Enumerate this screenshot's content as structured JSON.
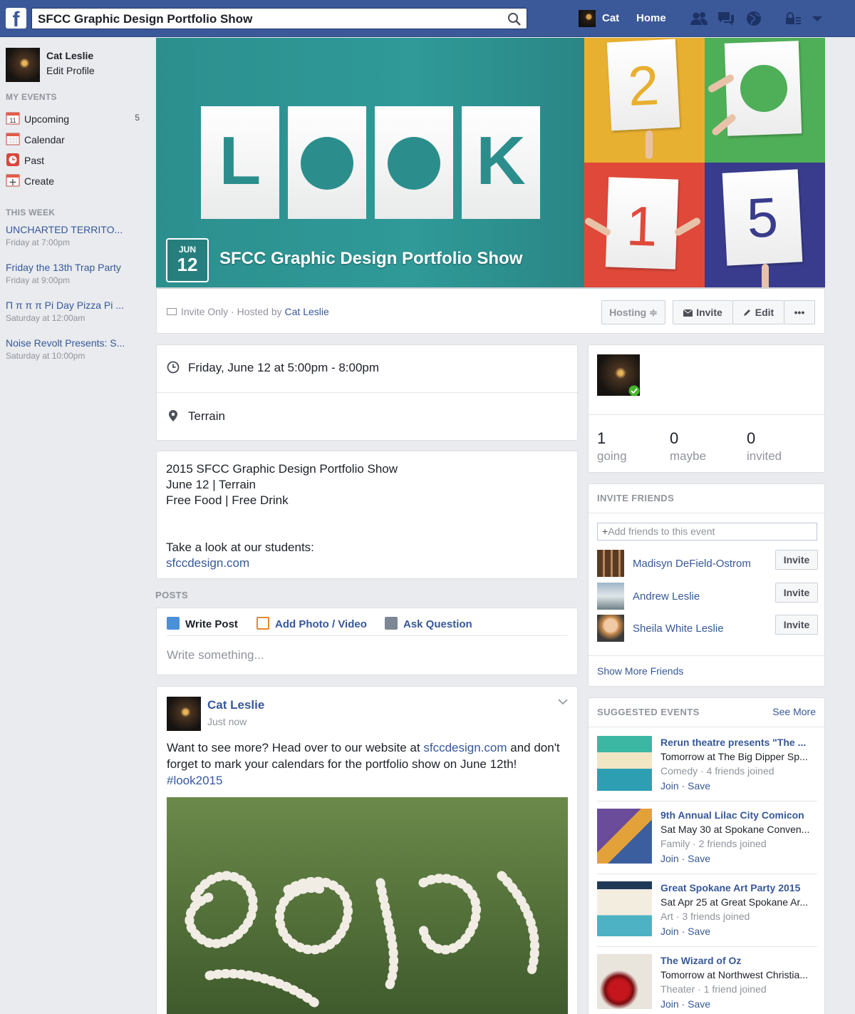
{
  "topbar": {
    "logo": "f",
    "search_value": "SFCC Graphic Design Portfolio Show",
    "user_name": "Cat",
    "home_label": "Home",
    "colors": {
      "bar": "#3b5998"
    }
  },
  "left": {
    "profile": {
      "name": "Cat Leslie",
      "edit": "Edit Profile"
    },
    "my_events_heading": "MY EVENTS",
    "menu": [
      {
        "label": "Upcoming",
        "count": "5",
        "icon": "calendar-11-icon",
        "icon_text": "11"
      },
      {
        "label": "Calendar",
        "icon": "calendar-grid-icon"
      },
      {
        "label": "Past",
        "icon": "clock-icon"
      },
      {
        "label": "Create",
        "icon": "plus-icon"
      }
    ],
    "this_week_heading": "THIS WEEK",
    "this_week": [
      {
        "title": "UNCHARTED TERRITO...",
        "time": "Friday at 7:00pm"
      },
      {
        "title": "Friday the 13th Trap Party",
        "time": "Friday at 9:00pm"
      },
      {
        "title": "Π π π π Pi Day Pizza Pi ...",
        "time": "Saturday at 12:00am"
      },
      {
        "title": "Noise Revolt Presents: S...",
        "time": "Saturday at 10:00pm"
      }
    ]
  },
  "cover": {
    "letters": [
      "L",
      "",
      "",
      "K"
    ],
    "digits": [
      "2",
      "",
      "1",
      "5"
    ],
    "date_month": "JUN",
    "date_day": "12",
    "title": "SFCC Graphic Design Portfolio Show",
    "colors": {
      "teal": "#2c8f8e",
      "yellow": "#e8b030",
      "green": "#4fae58",
      "red": "#e0493a",
      "blue": "#393b8c"
    }
  },
  "infobar": {
    "privacy": "Invite Only · Hosted by ",
    "host": "Cat Leslie",
    "hosting_label": "Hosting ≑",
    "invite_label": "Invite",
    "edit_label": "Edit",
    "more_label": "•••"
  },
  "details": {
    "datetime": "Friday, June 12 at 5:00pm - 8:00pm",
    "location": "Terrain"
  },
  "description": {
    "lines": [
      "2015 SFCC Graphic Design Portfolio Show",
      "June 12 | Terrain",
      "Free Food | Free Drink"
    ],
    "cta": "Take a look at our students:",
    "link": "sfccdesign.com"
  },
  "posts": {
    "heading": "POSTS",
    "tabs": [
      "Write Post",
      "Add Photo / Video",
      "Ask Question"
    ],
    "placeholder": "Write something..."
  },
  "post": {
    "author": "Cat Leslie",
    "time": "Just now",
    "text_before": "Want to see more? Head over to our website at ",
    "text_link": "sfccdesign.com",
    "text_after": " and don't forget to mark your calendars for the portfolio show on June 12th!",
    "hashtag": "#look2015"
  },
  "stats": [
    {
      "count": "1",
      "label": "going"
    },
    {
      "count": "0",
      "label": "maybe"
    },
    {
      "count": "0",
      "label": "invited"
    }
  ],
  "invite_friends": {
    "heading": "INVITE FRIENDS",
    "add_placeholder": "Add friends to this event",
    "friends": [
      {
        "name": "Madisyn DeField-Ostrom",
        "button": "Invite"
      },
      {
        "name": "Andrew Leslie",
        "button": "Invite"
      },
      {
        "name": "Sheila White Leslie",
        "button": "Invite"
      }
    ],
    "show_more": "Show More Friends"
  },
  "suggested": {
    "heading": "SUGGESTED EVENTS",
    "see_more": "See More",
    "events": [
      {
        "title": "Rerun theatre presents \"The ...",
        "when": "Tomorrow at The Big Dipper Sp...",
        "meta": "Comedy · 4 friends joined",
        "actions": "Join · Save"
      },
      {
        "title": "9th Annual Lilac City Comicon",
        "when": "Sat May 30 at Spokane Conven...",
        "meta": "Family · 2 friends joined",
        "actions": "Join · Save"
      },
      {
        "title": "Great Spokane Art Party 2015",
        "when": "Sat Apr 25 at Great Spokane Ar...",
        "meta": "Art · 3 friends joined",
        "actions": "Join · Save"
      },
      {
        "title": "The Wizard of Oz",
        "when": "Tomorrow at Northwest Christia...",
        "meta": "Theater · 1 friend joined",
        "actions": "Join · Save"
      }
    ]
  }
}
